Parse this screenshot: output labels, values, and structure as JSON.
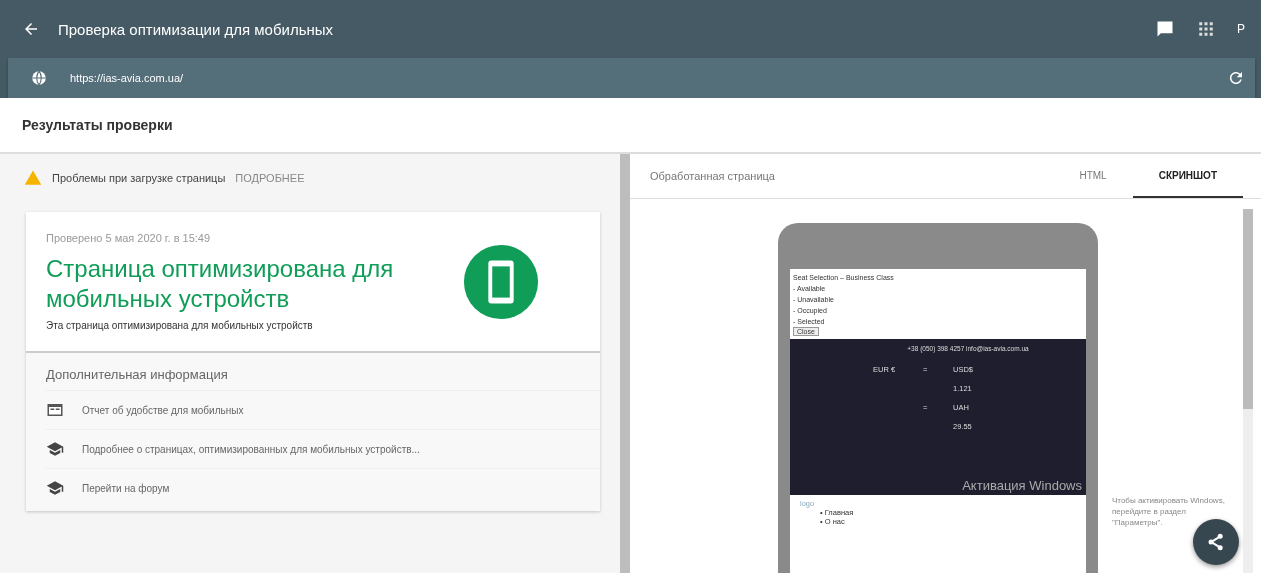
{
  "app_bar": {
    "title": "Проверка оптимизации для мобильных",
    "avatar": "P"
  },
  "url_bar": {
    "value": "https://ias-avia.com.ua/"
  },
  "results": {
    "title": "Результаты проверки"
  },
  "issues": {
    "text": "Проблемы при загрузке страницы",
    "link": "ПОДРОБНЕЕ"
  },
  "summary": {
    "checked": "Проверено 5 мая 2020 г. в 15:49",
    "title": "Страница оптимизирована для мобильных устройств",
    "description": "Эта страница оптимизирована для мобильных устройств"
  },
  "more_info": {
    "title": "Дополнительная информация",
    "links": [
      {
        "kind": "report",
        "label": "Отчет об удобстве для мобильных"
      },
      {
        "kind": "learn",
        "label": "Подробнее о страницах, оптимизированных для мобильных устройств..."
      },
      {
        "kind": "learn",
        "label": "Перейти на форум"
      }
    ]
  },
  "preview": {
    "title": "Обработанная страница",
    "tabs": [
      {
        "label": "HTML",
        "selected": false
      },
      {
        "label": "СКРИНШОТ",
        "selected": true
      }
    ],
    "screenshot": {
      "heading": "Seat Selection – Business Class",
      "options": [
        "- Available",
        "- Unavailable",
        "- Occupied",
        "- Selected"
      ],
      "button": "Close",
      "contact": "+38 (050) 398 4257  info@ias-avia.com.ua",
      "rates": [
        {
          "currency": "EUR €",
          "sign": "=",
          "value": "USD$"
        },
        {
          "value": "1.121"
        },
        {
          "sign": "=",
          "value": "UAH"
        },
        {
          "value": "29.55"
        }
      ],
      "logo_alt": "logo",
      "menu": [
        "• Главная",
        "• О нас"
      ]
    }
  },
  "os_notice": {
    "title": "Активация Windows",
    "text": "Чтобы активировать Windows, перейдите в раздел \"Параметры\"."
  }
}
